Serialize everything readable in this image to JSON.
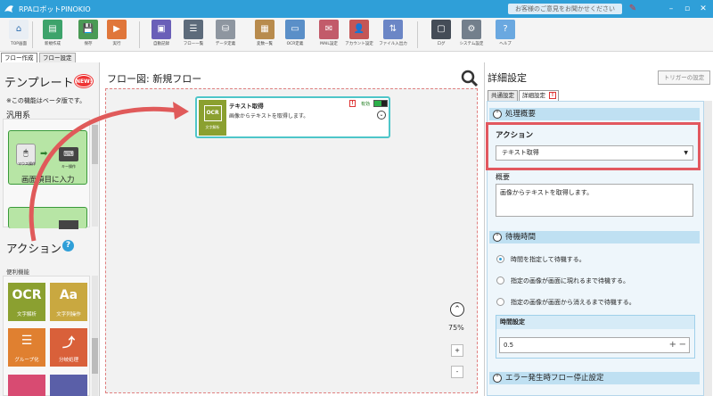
{
  "app": {
    "title": "RPAロボットPINOKIO",
    "feedback": "お客様のご意見をお聞かせください"
  },
  "toolbar": [
    {
      "label": "TOP画面",
      "icon": "top-screen-icon",
      "color": "#e9eef4"
    },
    {
      "label": "新規作成",
      "icon": "new-doc-icon",
      "color": "#3da36b"
    },
    {
      "label": "保存",
      "icon": "save-icon",
      "color": "#4a9a55"
    },
    {
      "label": "実行",
      "icon": "play-icon",
      "color": "#e0763a"
    },
    {
      "label": "自動記録",
      "icon": "record-icon",
      "color": "#6a5fb8"
    },
    {
      "label": "フロー一覧",
      "icon": "list-icon",
      "color": "#5d6b7b"
    },
    {
      "label": "データ定義",
      "icon": "database-icon",
      "color": "#8e96a0"
    },
    {
      "label": "変数一覧",
      "icon": "box-icon",
      "color": "#b88b4d"
    },
    {
      "label": "OCR定義",
      "icon": "ocr-icon",
      "color": "#5a8fc8"
    },
    {
      "label": "MAIL設定",
      "icon": "mail-icon",
      "color": "#c25b6a"
    },
    {
      "label": "アカウント設定",
      "icon": "account-icon",
      "color": "#c45656"
    },
    {
      "label": "ファイル入出力",
      "icon": "file-io-icon",
      "color": "#6b86c6"
    },
    {
      "label": "ログ",
      "icon": "log-icon",
      "color": "#444c57"
    },
    {
      "label": "システム設定",
      "icon": "gear-icon",
      "color": "#737f8c"
    },
    {
      "label": "ヘルプ",
      "icon": "help-icon",
      "color": "#6aa8e0"
    }
  ],
  "left": {
    "tabs": [
      "フロー作成",
      "フロー設定"
    ],
    "template_title": "テンプレート",
    "new_badge": "NEW!",
    "beta_note": "※この機能はベータ版です。",
    "category": "汎用系",
    "template_card": {
      "mouse": "マウス操作",
      "keyboard": "キー操作",
      "label": "画面項目に入力"
    },
    "action_title": "アクション",
    "help": "?",
    "action_group": "便利機能",
    "actions": [
      {
        "glyph": "OCR",
        "label": "文字解析",
        "color": "#8ba030",
        "icon": "ocr-icon"
      },
      {
        "glyph": "Aa",
        "label": "文字列操作",
        "color": "#c9a840",
        "icon": "text-icon"
      },
      {
        "glyph": "☰",
        "label": "グループ化",
        "color": "#e08030",
        "icon": "group-icon"
      },
      {
        "glyph": "⤴",
        "label": "分岐処理",
        "color": "#d9603a",
        "icon": "branch-icon"
      }
    ]
  },
  "center": {
    "title": "フロー図:  新規フロー",
    "node": {
      "icon_text": "OCR",
      "icon_sub": "文字解析",
      "name": "テキスト取得",
      "desc": "画像からテキストを取得します。",
      "warn": "!",
      "status": "有効"
    },
    "zoom": "75%",
    "zoom_in": "+",
    "zoom_out": "-"
  },
  "detail": {
    "title": "詳細設定",
    "trigger": "トリガーの設定",
    "tabs": [
      "共通設定",
      "詳細設定"
    ],
    "tab_warn": "!",
    "section1": "処理概要",
    "action_label": "アクション",
    "action_value": "テキスト取得",
    "summary_label": "概要",
    "summary_value": "画像からテキストを取得します。",
    "section2": "待機時間",
    "options": [
      "時間を指定して待機する。",
      "指定の画像が画面に現れるまで待機する。",
      "指定の画像が画面から消えるまで待機する。"
    ],
    "selected_option": 0,
    "time_label": "時間設定",
    "time_value": "0.5",
    "section3": "エラー発生時フロー停止設定"
  }
}
